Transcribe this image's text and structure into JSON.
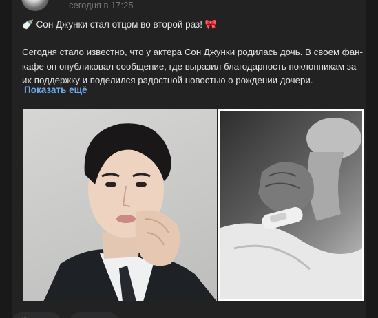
{
  "post": {
    "time": "сегодня в 17:25",
    "title": "🍼 Сон Джунки стал отцом во второй раз! 🎀",
    "body": "Сегодня стало известно, что у актера Сон Джунки родилась дочь. В своем фан-кафе он опубликовал сообщение, где выразил благодарность поклонникам за их поддержку и поделился радостной новостью о рождении дочери.",
    "show_more": "Показать ещё"
  },
  "colors": {
    "background": "#19191a",
    "card": "#222222",
    "text": "#e1e3e6",
    "muted": "#76787a",
    "link": "#71aaeb"
  },
  "images": [
    {
      "name": "actor-portrait-photo"
    },
    {
      "name": "newborn-hand-photo"
    }
  ],
  "actions": [
    {
      "icon": "heart-icon"
    },
    {
      "icon": "comment-icon"
    }
  ]
}
